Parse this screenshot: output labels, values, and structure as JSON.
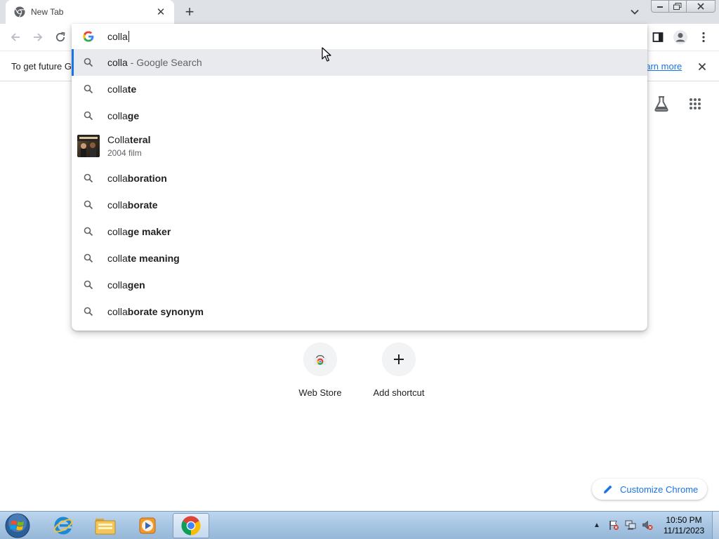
{
  "colors": {
    "accent": "#1a73e8",
    "tabstrip_bg": "#dee1e6",
    "selected_row_bg": "#e8eaed",
    "taskbar_bg": "#a9c7e4"
  },
  "tab": {
    "title": "New Tab",
    "favicon": "chrome-icon",
    "close_icon": "close-icon"
  },
  "toolbar": {
    "back_icon": "back-arrow-icon",
    "forward_icon": "forward-arrow-icon",
    "reload_icon": "reload-icon",
    "side_panel_icon": "side-panel-icon",
    "profile_icon": "profile-avatar-icon",
    "menu_icon": "kebab-menu-icon"
  },
  "omnibox": {
    "input_value": "colla",
    "suggestions": [
      {
        "typed": "colla",
        "rest": "",
        "suffix": " - Google Search",
        "selected": true
      },
      {
        "typed": "colla",
        "rest": "te"
      },
      {
        "typed": "colla",
        "rest": "ge"
      },
      {
        "entity": true,
        "typed": "Colla",
        "rest": "teral",
        "description": "2004 film"
      },
      {
        "typed": "colla",
        "rest": "boration"
      },
      {
        "typed": "colla",
        "rest": "borate"
      },
      {
        "typed": "colla",
        "rest": "ge maker"
      },
      {
        "typed": "colla",
        "rest": "te meaning"
      },
      {
        "typed": "colla",
        "rest": "gen"
      },
      {
        "typed": "colla",
        "rest": "borate synonym"
      }
    ]
  },
  "infobar": {
    "text": "To get future G",
    "link": "earn more"
  },
  "ntp": {
    "shortcuts": [
      {
        "label": "Web Store",
        "icon": "web-store-icon"
      },
      {
        "label": "Add shortcut",
        "icon": "plus-icon"
      }
    ],
    "customize_label": "Customize Chrome"
  },
  "taskbar": {
    "time": "10:50 PM",
    "date": "11/11/2023",
    "pinned": [
      "internet-explorer-icon",
      "file-explorer-icon",
      "media-player-icon",
      "chrome-icon"
    ]
  }
}
